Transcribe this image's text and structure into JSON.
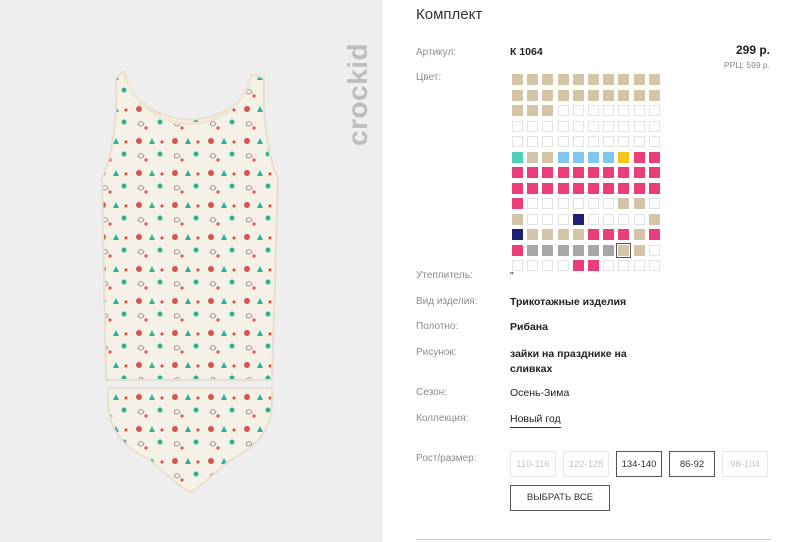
{
  "product": {
    "title": "Комплект",
    "article_label": "Артикул:",
    "article_value": "К 1064",
    "price": "299 р.",
    "rrp": "РРЦ: 599 р.",
    "color_label": "Цвет:"
  },
  "brand": {
    "logo_text": "crockid"
  },
  "attributes": [
    {
      "label": "Утеплитель:",
      "value": "\""
    },
    {
      "label": "Вид изделия:",
      "value": "Трикотажные изделия"
    },
    {
      "label": "Полотно:",
      "value": "Рибана"
    },
    {
      "label": "Рисунок:",
      "value": "зайки на празднике на сливках"
    },
    {
      "label": "Сезон:",
      "value": "Осень-Зима"
    },
    {
      "label": "Коллекция:",
      "value": "Новый год"
    }
  ],
  "sizes_label": "Рост/размер:",
  "sizes": [
    {
      "label": "110-116",
      "available": false
    },
    {
      "label": "122-128",
      "available": false
    },
    {
      "label": "134-140",
      "available": true
    },
    {
      "label": "86-92",
      "available": true
    },
    {
      "label": "98-104",
      "available": false
    }
  ],
  "select_all_label": "ВЫБРАТЬ ВСЕ",
  "colors": {
    "beige": "#d4c4a8",
    "mint": "#4dd0b5",
    "sky": "#7fc6f0",
    "yellow": "#f5c518",
    "pink": "#ec3d7b",
    "navy": "#1c1f73",
    "grey": "#a7a7a7"
  },
  "swatch_rows": [
    [
      "B",
      "B",
      "B",
      "B",
      "B",
      "B",
      "B",
      "B",
      "B",
      "B"
    ],
    [
      "B",
      "B",
      "B",
      "B",
      "B",
      "B",
      "B",
      "B",
      "B",
      "B"
    ],
    [
      "B",
      "B",
      "B",
      "-",
      "-",
      "-",
      "-",
      "-",
      "-",
      "-"
    ],
    [
      "-",
      "-",
      "-",
      "-",
      "-",
      "-",
      "-",
      "-",
      "-",
      "-"
    ],
    [
      "-",
      "-",
      "-",
      "-",
      "-",
      "-",
      "-",
      "-",
      "-",
      "-"
    ],
    [
      "M",
      "B",
      "B",
      "S",
      "S",
      "S",
      "S",
      "Y",
      "P",
      "P"
    ],
    [
      "P",
      "P",
      "P",
      "P",
      "P",
      "P",
      "P",
      "P",
      "P",
      "P"
    ],
    [
      "P",
      "P",
      "P",
      "P",
      "P",
      "P",
      "P",
      "P",
      "P",
      "P"
    ],
    [
      "P",
      "-",
      "-",
      "-",
      "-",
      "-",
      "-",
      "B",
      "B",
      "-"
    ],
    [
      "B",
      "-",
      "-",
      "-",
      "N",
      "-",
      "-",
      "-",
      "-",
      "B"
    ],
    [
      "N",
      "B",
      "B",
      "B",
      "B",
      "P",
      "P",
      "P",
      "B",
      "P"
    ],
    [
      "P",
      "G",
      "G",
      "G",
      "G",
      "G",
      "G",
      "Bs",
      "B",
      "-"
    ],
    [
      "-",
      "-",
      "-",
      "-",
      "P",
      "P",
      "-",
      "-",
      "-",
      "-"
    ]
  ]
}
